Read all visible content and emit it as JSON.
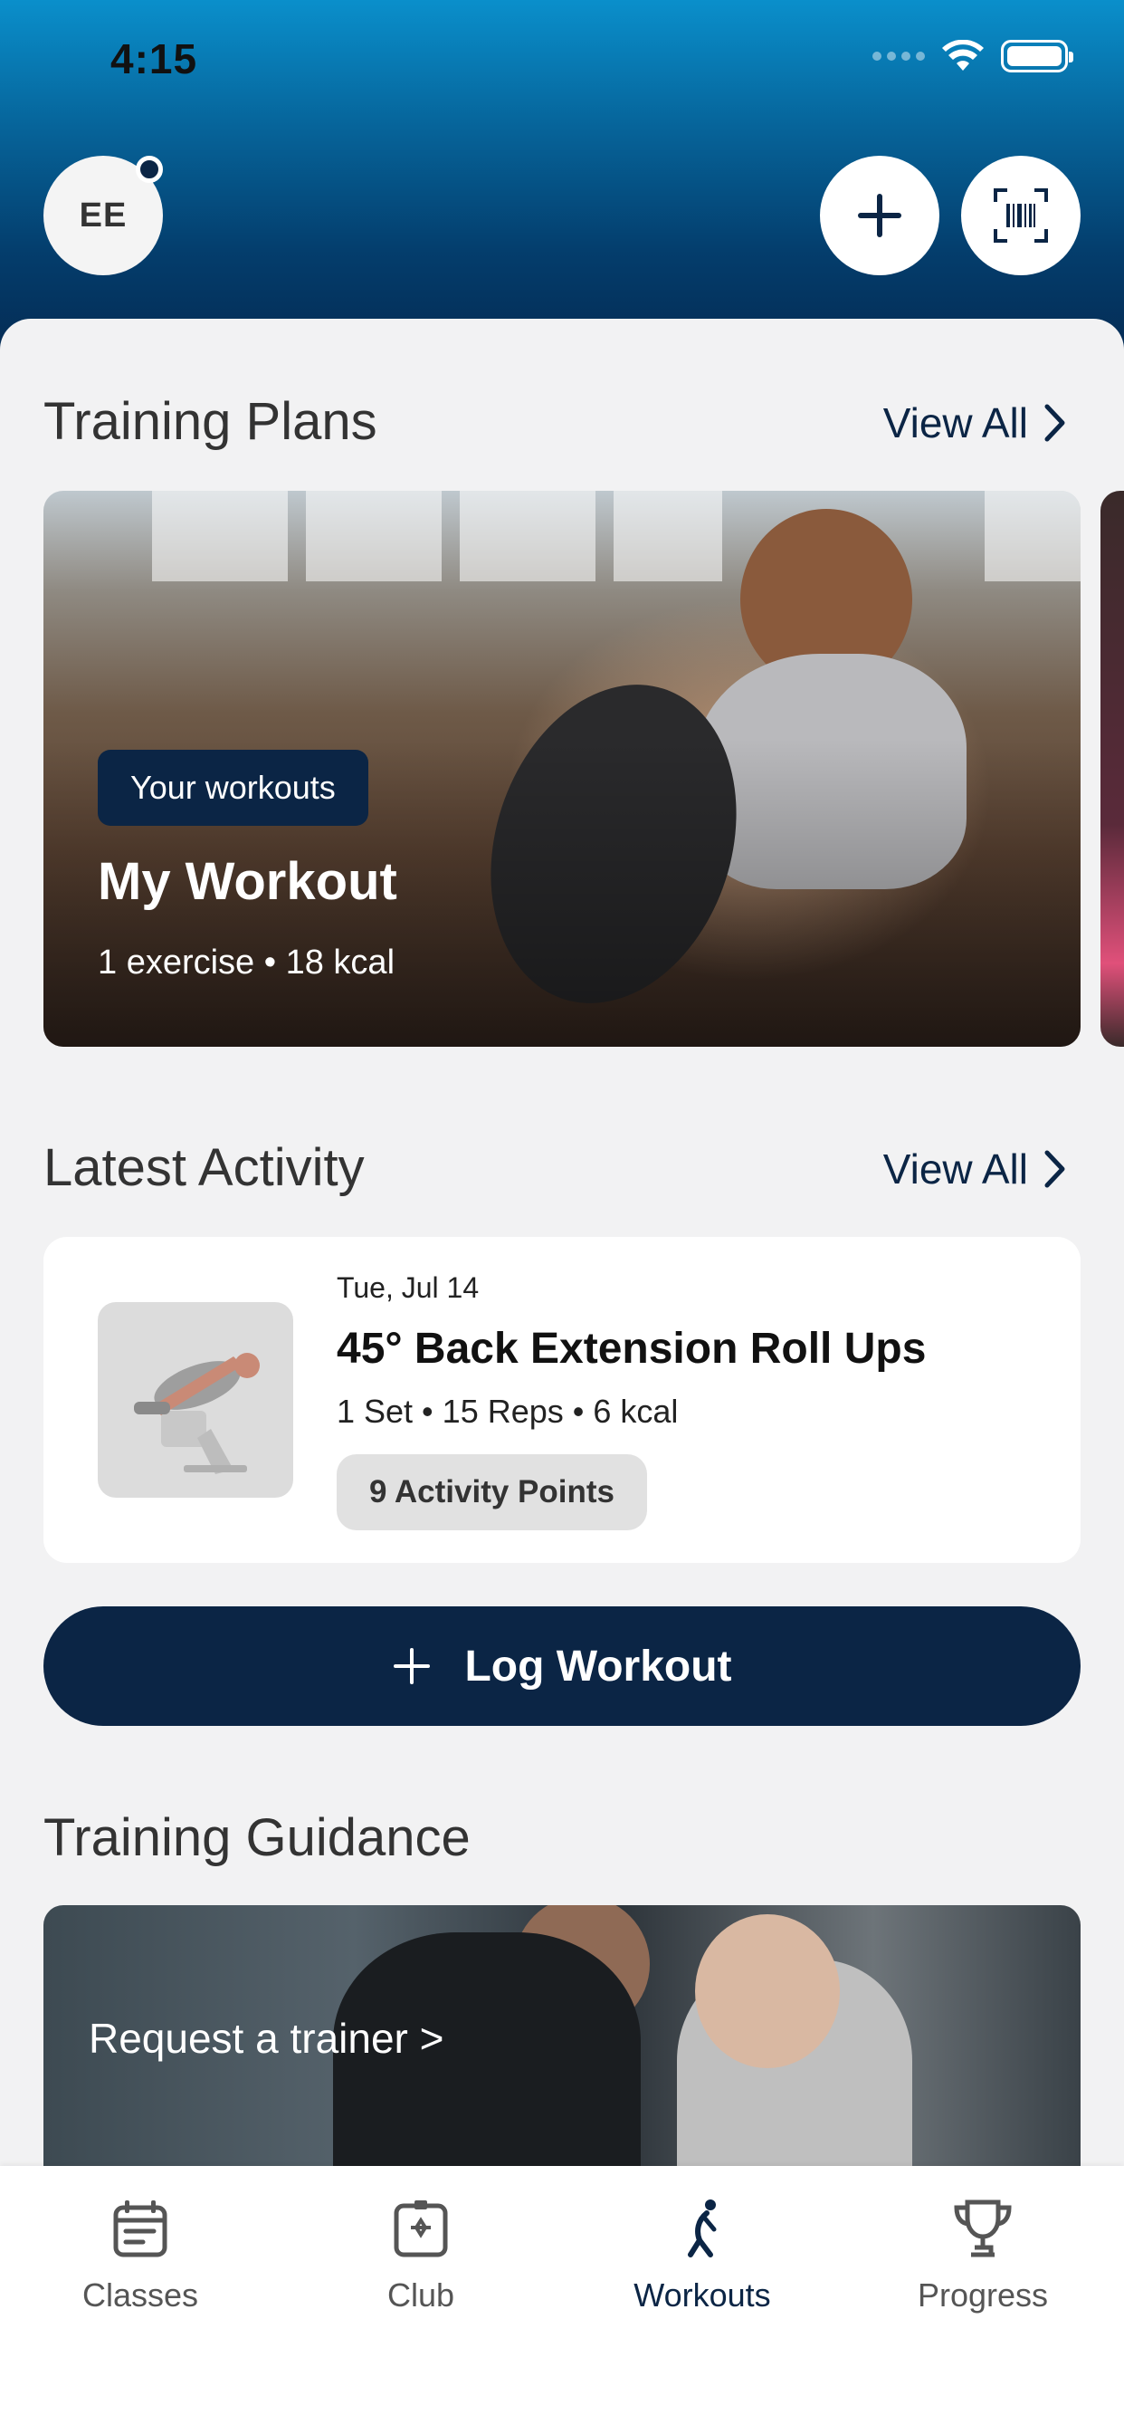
{
  "status_bar": {
    "time": "4:15"
  },
  "header": {
    "avatar_initials": "EE",
    "add_icon": "plus-icon",
    "scan_icon": "barcode-scan-icon"
  },
  "training_plans": {
    "title": "Training Plans",
    "view_all": "View All",
    "card": {
      "tag": "Your workouts",
      "title": "My Workout",
      "subtitle": "1 exercise • 18 kcal"
    }
  },
  "latest_activity": {
    "title": "Latest Activity",
    "view_all": "View All",
    "item": {
      "date": "Tue, Jul 14",
      "title": "45° Back Extension Roll Ups",
      "meta": "1 Set • 15 Reps • 6 kcal",
      "points": "9 Activity Points"
    }
  },
  "log_workout": {
    "label": "Log Workout"
  },
  "training_guidance": {
    "title": "Training Guidance",
    "banner_text": "Request a trainer >"
  },
  "tabs": [
    {
      "label": "Classes",
      "icon": "calendar-icon",
      "active": false
    },
    {
      "label": "Club",
      "icon": "club-icon",
      "active": false
    },
    {
      "label": "Workouts",
      "icon": "runner-icon",
      "active": true
    },
    {
      "label": "Progress",
      "icon": "trophy-icon",
      "active": false
    }
  ],
  "colors": {
    "primary": "#0b2545",
    "header_top": "#0a8fcb",
    "background": "#f2f2f3"
  }
}
